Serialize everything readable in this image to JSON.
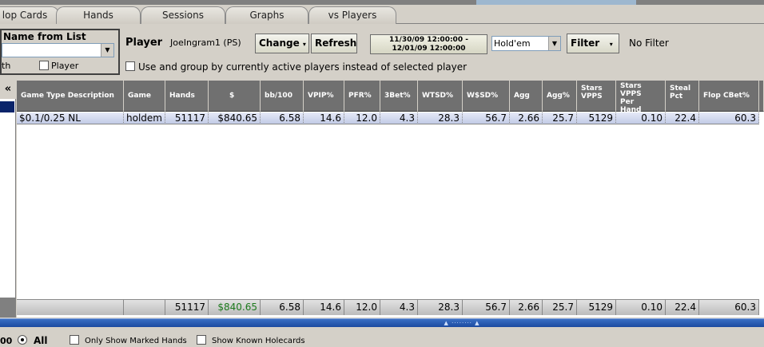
{
  "tabs": [
    "lop Cards",
    "Hands",
    "Sessions",
    "Graphs",
    "vs Players"
  ],
  "left_panel": {
    "title": "Name from List",
    "fragment_text": "th",
    "player_checkbox_label": "Player"
  },
  "toolbar": {
    "player_label": "Player",
    "player_name": "JoeIngram1 (PS)",
    "change_label": "Change",
    "refresh_label": "Refresh",
    "date_from": "11/30/09 12:00:00 -",
    "date_to": "12/01/09 12:00:00",
    "game_value": "Hold'em",
    "filter_label": "Filter",
    "filter_status": "No Filter",
    "group_option_label": "Use and group by currently active players instead of selected player"
  },
  "grid": {
    "collapse_glyph": "«",
    "columns": [
      {
        "label": "Game Type Description"
      },
      {
        "label": "Game"
      },
      {
        "label": "Hands"
      },
      {
        "label": "$"
      },
      {
        "label": "bb/100"
      },
      {
        "label": "VPIP%"
      },
      {
        "label": "PFR%"
      },
      {
        "label": "3Bet%"
      },
      {
        "label": "WTSD%"
      },
      {
        "label": "W$SD%"
      },
      {
        "label": "Agg"
      },
      {
        "label": "Agg%"
      },
      {
        "label": "Stars VPPS"
      },
      {
        "label": "Stars VPPS Per Hand"
      },
      {
        "label": "Steal Pct"
      },
      {
        "label": "Flop CBet%"
      }
    ],
    "row": [
      "$0.1/0.25 NL",
      "holdem",
      "51117",
      "$840.65",
      "6.58",
      "14.6",
      "12.0",
      "4.3",
      "28.3",
      "56.7",
      "2.66",
      "25.7",
      "5129",
      "0.10",
      "22.4",
      "60.3"
    ],
    "totals": [
      "",
      "",
      "51117",
      "$840.65",
      "6.58",
      "14.6",
      "12.0",
      "4.3",
      "28.3",
      "56.7",
      "2.66",
      "25.7",
      "5129",
      "0.10",
      "22.4",
      "60.3"
    ]
  },
  "bottom": {
    "left_fragment": "00",
    "all_label": "All",
    "marked_hands_label": "Only Show Marked Hands",
    "known_holecards_label": "Show Known Holecards"
  },
  "colors": {
    "header_bg": "#707070",
    "selected_row": "#c2cbe6",
    "splitter": "#1b4aa0",
    "money_green": "#1d7a1d"
  }
}
